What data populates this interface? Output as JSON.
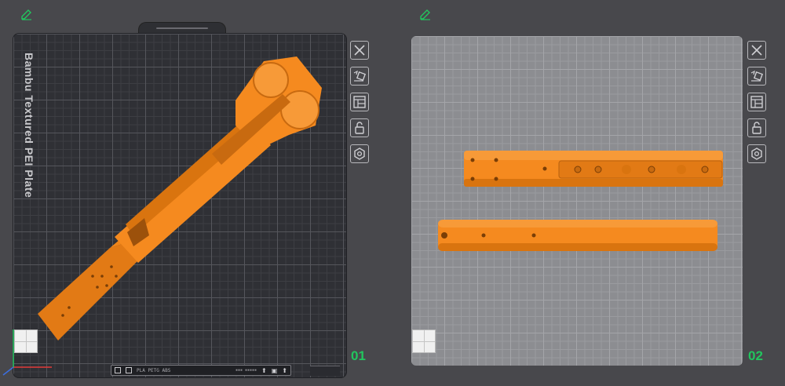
{
  "plates": [
    {
      "label": "Bambu Textured PEI Plate",
      "number": "01",
      "filament_info": "PLA PETG ABS",
      "filament_info_small": "▪▪▪ ▪▪▪▪▪"
    },
    {
      "number": "02"
    }
  ],
  "toolbar_icons": [
    "close-icon",
    "auto-orient-icon",
    "arrange-icon",
    "lock-icon",
    "settings-icon"
  ],
  "colors": {
    "model": "#f58a1f",
    "model_shadow": "#c86a10",
    "plate_number": "#22c55e",
    "edit_icon": "#22c55e"
  }
}
